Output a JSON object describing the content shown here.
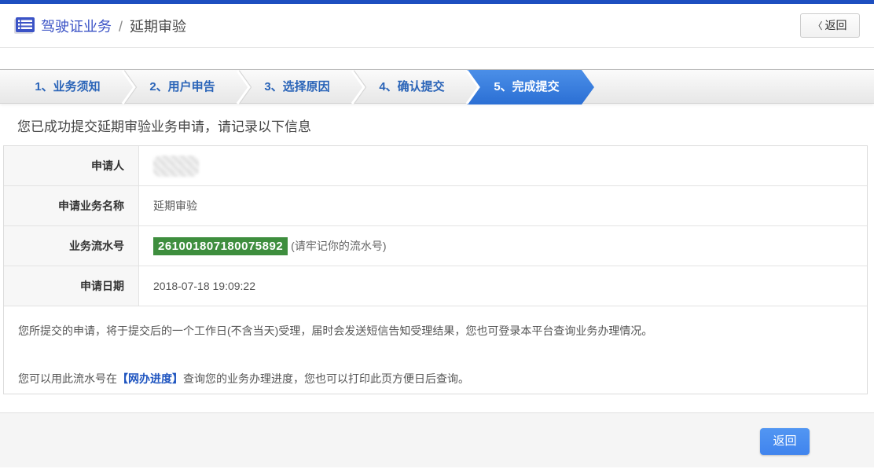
{
  "header": {
    "title_primary": "驾驶证业务",
    "title_separator": "/",
    "title_secondary": "延期审验",
    "back_label": "返回"
  },
  "icons": {
    "back_chevron": "〈",
    "title_icon": "list-form-icon"
  },
  "steps": {
    "items": [
      {
        "label": "1、业务须知",
        "active": false
      },
      {
        "label": "2、用户申告",
        "active": false
      },
      {
        "label": "3、选择原因",
        "active": false
      },
      {
        "label": "4、确认提交",
        "active": false
      },
      {
        "label": "5、完成提交",
        "active": true
      }
    ]
  },
  "result": {
    "message": "您已成功提交延期审验业务申请，请记录以下信息",
    "rows": [
      {
        "label": "申请人",
        "value_type": "redacted"
      },
      {
        "label": "申请业务名称",
        "value": "延期审验"
      },
      {
        "label": "业务流水号",
        "badge": "261001807180075892",
        "note": "(请牢记你的流水号)"
      },
      {
        "label": "申请日期",
        "value": "2018-07-18 19:09:22"
      }
    ],
    "notes": [
      {
        "text": "您所提交的申请，将于提交后的一个工作日(不含当天)受理，届时会发送短信告知受理结果，您也可登录本平台查询业务办理情况。"
      },
      {
        "pre": "您可以用此流水号在",
        "link": "【网办进度】",
        "post": "查询您的业务办理进度，您也可以打印此页方便日后查询。"
      }
    ]
  },
  "footer": {
    "back_label": "返回"
  },
  "colors": {
    "topbar_blue": "#1d4fc0",
    "active_tab_blue": "#2b6fd4",
    "button_blue": "#4a8ff0",
    "badge_green": "#3e8e3e",
    "link_blue": "#1f55c0",
    "tab_text_blue": "#2a64b8"
  }
}
